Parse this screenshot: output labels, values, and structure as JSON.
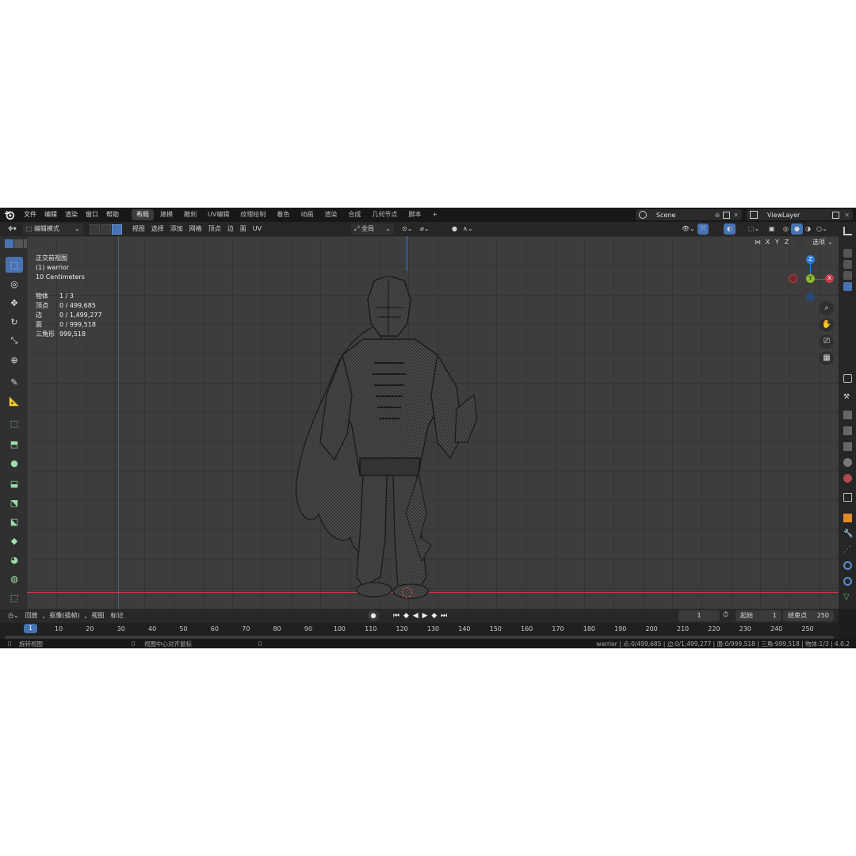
{
  "app": {
    "name": "Blender",
    "version": "4.0.2"
  },
  "topbar": {
    "menus": [
      "文件",
      "编辑",
      "渲染",
      "窗口",
      "帮助"
    ],
    "workspaces": [
      "布局",
      "建模",
      "雕刻",
      "UV编辑",
      "纹理绘制",
      "着色",
      "动画",
      "渲染",
      "合成",
      "几何节点",
      "脚本"
    ],
    "active_workspace": "布局",
    "add_tab": "+",
    "scene": "Scene",
    "view_layer": "ViewLayer"
  },
  "header": {
    "mode": "编辑模式",
    "menus": [
      "视图",
      "选择",
      "添加",
      "网格",
      "顶点",
      "边",
      "面",
      "UV"
    ],
    "transform_orientation": "全局",
    "axes": [
      "X",
      "Y",
      "Z"
    ],
    "options_label": "选项"
  },
  "viewport": {
    "view_name": "正交前视图",
    "object": "(1) warrior",
    "scale": "10 Centimeters",
    "stats": [
      {
        "label": "物体",
        "value": "1 / 3"
      },
      {
        "label": "顶点",
        "value": "0 / 499,685"
      },
      {
        "label": "边",
        "value": "0 / 1,499,277"
      },
      {
        "label": "面",
        "value": "0 / 999,518"
      },
      {
        "label": "三角形",
        "value": "999,518"
      }
    ],
    "gizmo": {
      "z": "Z",
      "y": "Y",
      "x": "X"
    }
  },
  "timeline": {
    "menus": [
      "回放",
      "抠像(插帧)",
      "视图",
      "标记"
    ],
    "current_frame": "1",
    "start_label": "起始",
    "start": "1",
    "end_label": "结束点",
    "end": "250",
    "ticks": [
      "10",
      "20",
      "30",
      "40",
      "50",
      "60",
      "70",
      "80",
      "90",
      "100",
      "110",
      "120",
      "130",
      "140",
      "150",
      "160",
      "170",
      "180",
      "190",
      "200",
      "210",
      "220",
      "230",
      "240",
      "250"
    ]
  },
  "statusbar": {
    "left_hint": "旋转视图",
    "mid_hint": "视图中心对齐鼠标",
    "info": "warrior | 点:0/499,685 | 边:0/1,499,277 | 面:0/999,518 | 三角:999,518 | 物体:1/3 | 4.0.2"
  },
  "colors": {
    "accent": "#4772b3",
    "x_axis": "#c43c4b",
    "y_axis": "#8bb82d",
    "z_axis": "#2f7ee0"
  }
}
